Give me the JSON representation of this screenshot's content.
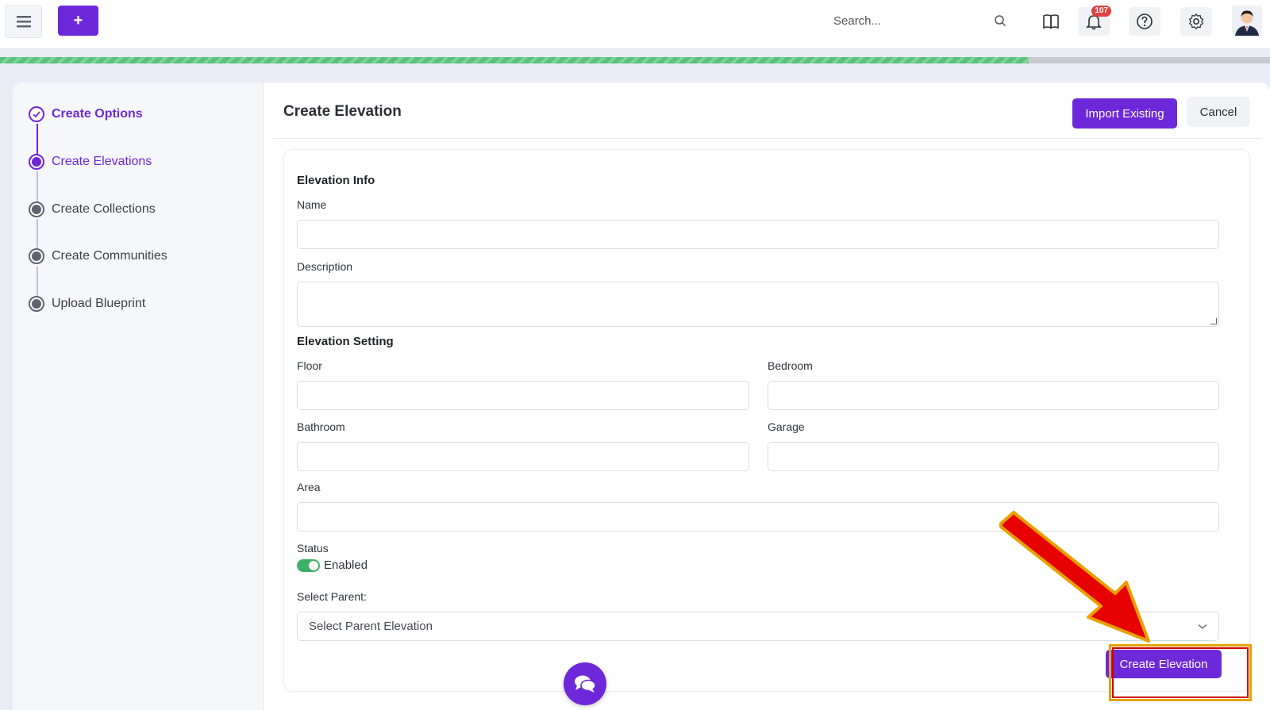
{
  "topbar": {
    "add_label": "+",
    "search_placeholder": "Search...",
    "notification_count": "107"
  },
  "progress": {
    "fraction": 0.81
  },
  "stepper": {
    "steps": [
      {
        "label": "Create Options",
        "state": "done"
      },
      {
        "label": "Create Elevations",
        "state": "active"
      },
      {
        "label": "Create Collections",
        "state": "todo"
      },
      {
        "label": "Create Communities",
        "state": "todo"
      },
      {
        "label": "Upload Blueprint",
        "state": "todo"
      }
    ]
  },
  "header": {
    "title": "Create Elevation",
    "import_label": "Import Existing",
    "cancel_label": "Cancel"
  },
  "form": {
    "section_info": "Elevation Info",
    "name_label": "Name",
    "name_value": "",
    "description_label": "Description",
    "description_value": "",
    "section_setting": "Elevation Setting",
    "floor_label": "Floor",
    "bedroom_label": "Bedroom",
    "bathroom_label": "Bathroom",
    "garage_label": "Garage",
    "area_label": "Area",
    "status_label": "Status",
    "status_value": "Enabled",
    "parent_label": "Select Parent:",
    "parent_placeholder": "Select Parent Elevation",
    "submit_label": "Create Elevation"
  },
  "colors": {
    "accent": "#6d28d9",
    "success": "#3fae67",
    "annotation_arrow": "#e60000",
    "annotation_outline": "#e8a000"
  }
}
